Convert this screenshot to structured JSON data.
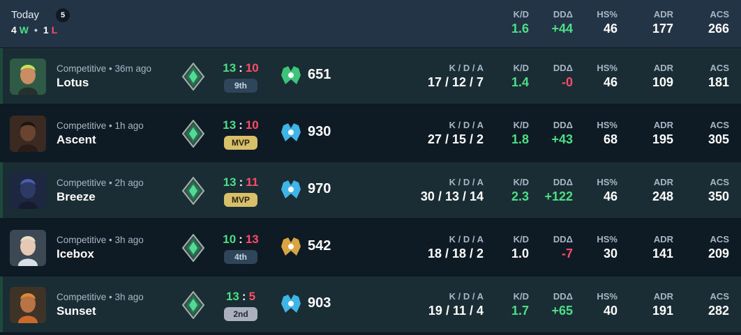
{
  "summary": {
    "title": "Today",
    "count": "5",
    "wins": "4",
    "wins_suffix": "W",
    "separator": "•",
    "losses": "1",
    "losses_suffix": "L",
    "stats": [
      {
        "label": "K/D",
        "value": "1.6",
        "tone": "green"
      },
      {
        "label": "DDΔ",
        "value": "+44",
        "tone": "green"
      },
      {
        "label": "HS%",
        "value": "46",
        "tone": "white"
      },
      {
        "label": "ADR",
        "value": "177",
        "tone": "white"
      },
      {
        "label": "ACS",
        "value": "266",
        "tone": "white"
      }
    ]
  },
  "colors": {
    "green": "#4ddf85",
    "red": "#ff4d67",
    "win_row": "#1a2d34",
    "loss_row": "#0e1a24",
    "header": "#243447"
  },
  "labels": {
    "kda": "K / D / A",
    "kd": "K/D",
    "dd": "DDΔ",
    "hs": "HS%",
    "adr": "ADR",
    "acs": "ACS",
    "colon": ":"
  },
  "matches": [
    {
      "meta": "Competitive • 36m ago",
      "map": "Lotus",
      "agent_icon": "agent-portrait-icon",
      "score_team": "13",
      "score_enemy": "10",
      "team_tone": "green",
      "enemy_tone": "red",
      "placement": "9th",
      "placement_style": "normal",
      "rr_icon": "rank-green-icon",
      "rr": "651",
      "kda": "17 / 12 / 7",
      "kd": "1.4",
      "kd_tone": "green",
      "dd": "-0",
      "dd_tone": "red",
      "hs": "46",
      "adr": "109",
      "acs": "181",
      "result": "win"
    },
    {
      "meta": "Competitive • 1h ago",
      "map": "Ascent",
      "agent_icon": "agent-portrait-icon",
      "score_team": "13",
      "score_enemy": "10",
      "team_tone": "green",
      "enemy_tone": "red",
      "placement": "MVP",
      "placement_style": "mvp",
      "rr_icon": "rank-blue-icon",
      "rr": "930",
      "kda": "27 / 15 / 2",
      "kd": "1.8",
      "kd_tone": "green",
      "dd": "+43",
      "dd_tone": "green",
      "hs": "68",
      "adr": "195",
      "acs": "305",
      "result": "loss"
    },
    {
      "meta": "Competitive • 2h ago",
      "map": "Breeze",
      "agent_icon": "agent-portrait-icon",
      "score_team": "13",
      "score_enemy": "11",
      "team_tone": "green",
      "enemy_tone": "red",
      "placement": "MVP",
      "placement_style": "mvp",
      "rr_icon": "rank-blue-icon",
      "rr": "970",
      "kda": "30 / 13 / 14",
      "kd": "2.3",
      "kd_tone": "green",
      "dd": "+122",
      "dd_tone": "green",
      "hs": "46",
      "adr": "248",
      "acs": "350",
      "result": "win"
    },
    {
      "meta": "Competitive • 3h ago",
      "map": "Icebox",
      "agent_icon": "agent-portrait-icon",
      "score_team": "10",
      "score_enemy": "13",
      "team_tone": "green",
      "enemy_tone": "red",
      "placement": "4th",
      "placement_style": "normal",
      "rr_icon": "rank-gold-icon",
      "rr": "542",
      "kda": "18 / 18 / 2",
      "kd": "1.0",
      "kd_tone": "white",
      "dd": "-7",
      "dd_tone": "red",
      "hs": "30",
      "adr": "141",
      "acs": "209",
      "result": "loss"
    },
    {
      "meta": "Competitive • 3h ago",
      "map": "Sunset",
      "agent_icon": "agent-portrait-icon",
      "score_team": "13",
      "score_enemy": "5",
      "team_tone": "green",
      "enemy_tone": "red",
      "placement": "2nd",
      "placement_style": "silver",
      "rr_icon": "rank-blue-icon",
      "rr": "903",
      "kda": "19 / 11 / 4",
      "kd": "1.7",
      "kd_tone": "green",
      "dd": "+65",
      "dd_tone": "green",
      "hs": "40",
      "adr": "191",
      "acs": "282",
      "result": "win"
    }
  ]
}
